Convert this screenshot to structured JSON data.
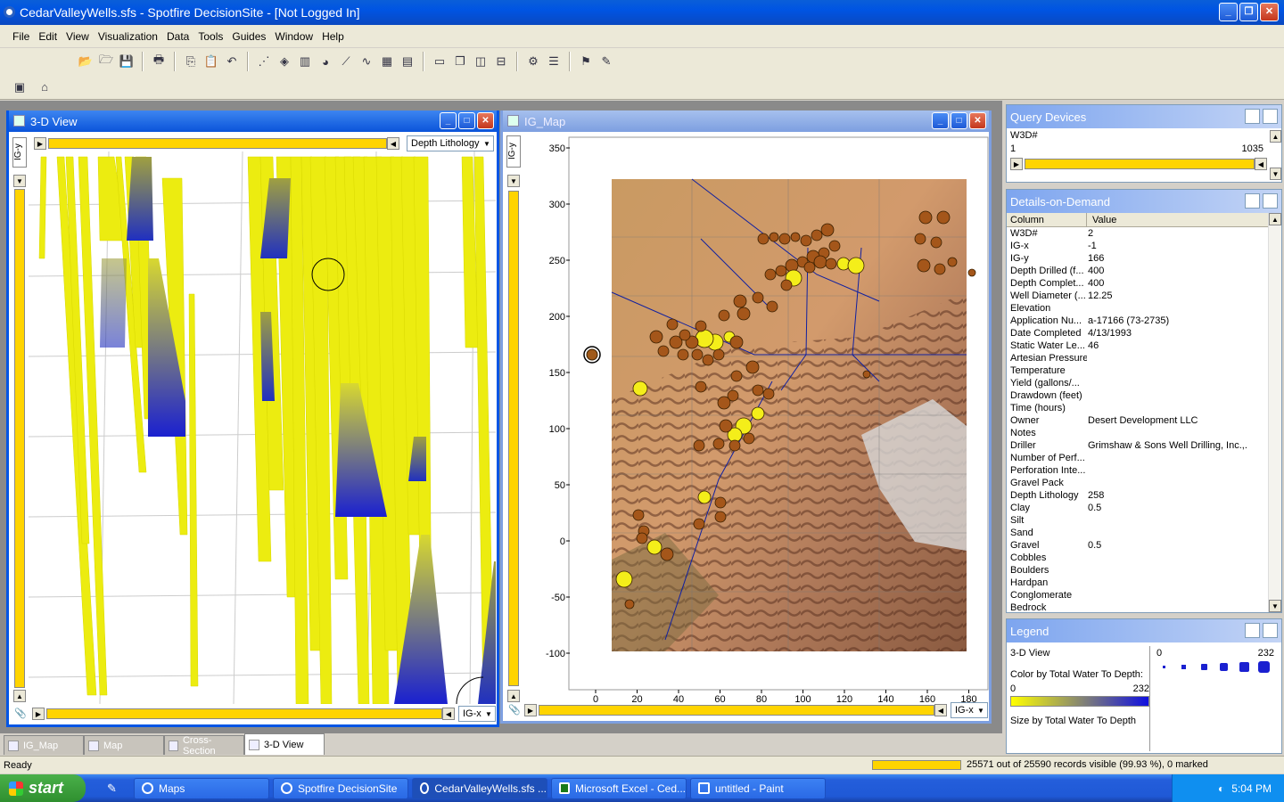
{
  "window": {
    "title": "CedarValleyWells.sfs - Spotfire DecisionSite - [Not Logged In]"
  },
  "menu": [
    "File",
    "Edit",
    "View",
    "Visualization",
    "Data",
    "Tools",
    "Guides",
    "Window",
    "Help"
  ],
  "view3d": {
    "title": "3-D View",
    "color_combo": "Depth Lithology",
    "y_axis": "IG-y",
    "x_axis": "IG-x"
  },
  "igmap": {
    "title": "IG_Map",
    "y_axis": "IG-y",
    "x_axis": "IG-x",
    "y_ticks": [
      "350",
      "300",
      "250",
      "200",
      "150",
      "100",
      "50",
      "0",
      "-50",
      "-100"
    ],
    "x_ticks": [
      "0",
      "20",
      "40",
      "60",
      "80",
      "100",
      "120",
      "140",
      "160",
      "180"
    ]
  },
  "tabs": [
    "IG_Map",
    "Map",
    "Cross-Section",
    "3-D View"
  ],
  "query_devices": {
    "title": "Query Devices",
    "label": "W3D#",
    "min": "1",
    "max": "1035"
  },
  "details": {
    "title": "Details-on-Demand",
    "col_header": "Column",
    "val_header": "Value",
    "rows": [
      [
        "W3D#",
        "2"
      ],
      [
        "IG-x",
        "-1"
      ],
      [
        "IG-y",
        "166"
      ],
      [
        "Depth Drilled (f...",
        "400"
      ],
      [
        "Depth Complet...",
        "400"
      ],
      [
        "Well Diameter (...",
        "12.25"
      ],
      [
        "Elevation",
        ""
      ],
      [
        "Application Nu...",
        "a-17166 (73-2735)"
      ],
      [
        "Date Completed",
        "4/13/1993"
      ],
      [
        "Static Water Le...",
        "46"
      ],
      [
        "Artesian Pressure",
        ""
      ],
      [
        "Temperature",
        ""
      ],
      [
        "Yield (gallons/...",
        ""
      ],
      [
        "Drawdown (feet)",
        ""
      ],
      [
        "Time (hours)",
        ""
      ],
      [
        "Owner",
        "Desert Development LLC"
      ],
      [
        "Notes",
        ""
      ],
      [
        "Driller",
        "Grimshaw & Sons Well Drilling, Inc.,..."
      ],
      [
        "Number of Perf...",
        ""
      ],
      [
        "Perforation Inte...",
        ""
      ],
      [
        "Gravel Pack",
        ""
      ],
      [
        "Depth Lithology",
        "258"
      ],
      [
        "Clay",
        "0.5"
      ],
      [
        "Silt",
        ""
      ],
      [
        "Sand",
        ""
      ],
      [
        "Gravel",
        "0.5"
      ],
      [
        "Cobbles",
        ""
      ],
      [
        "Boulders",
        ""
      ],
      [
        "Hardpan",
        ""
      ],
      [
        "Conglomerate",
        ""
      ],
      [
        "Bedrock",
        ""
      ]
    ]
  },
  "legend": {
    "title": "Legend",
    "view": "3-D View",
    "color_by": "Color by Total Water To Depth:",
    "color_min": "0",
    "color_max": "232",
    "size_min": "0",
    "size_max": "232",
    "size_by": "Size by Total Water To Depth"
  },
  "status": {
    "left": "Ready",
    "right": "25571 out of 25590 records visible (99.93 %), 0 marked"
  },
  "taskbar": {
    "start": "start",
    "items": [
      "Maps",
      "Spotfire DecisionSite",
      "CedarValleyWells.sfs ...",
      "Microsoft Excel - Ced...",
      "untitled - Paint"
    ],
    "clock": "5:04 PM"
  },
  "colors": {
    "accent": "#0054e3",
    "slider": "#ffd400",
    "well_yellow": "#f0f000",
    "well_blue": "#1020d0"
  }
}
